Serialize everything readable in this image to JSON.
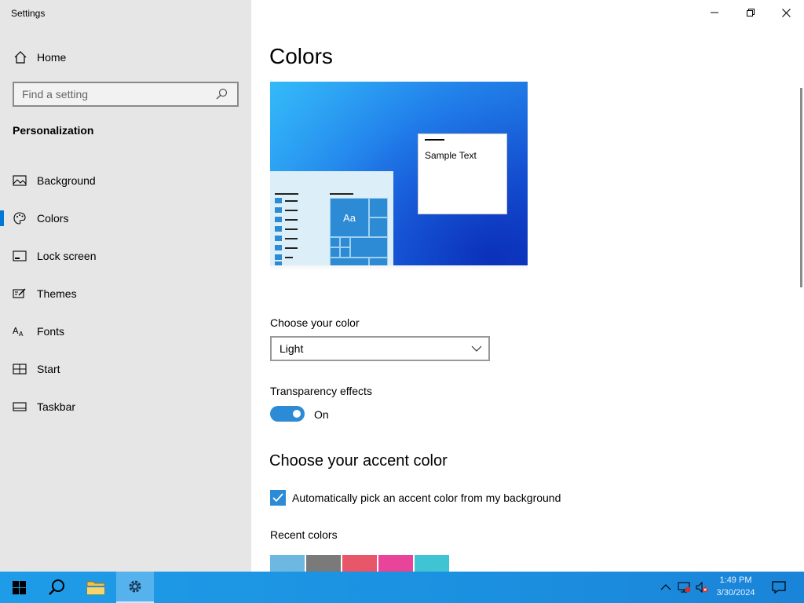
{
  "app": {
    "title": "Settings"
  },
  "sidebar": {
    "home": "Home",
    "search_placeholder": "Find a setting",
    "section": "Personalization",
    "items": [
      {
        "label": "Background",
        "icon": "picture-icon"
      },
      {
        "label": "Colors",
        "icon": "palette-icon",
        "selected": true
      },
      {
        "label": "Lock screen",
        "icon": "lock-screen-icon"
      },
      {
        "label": "Themes",
        "icon": "themes-icon"
      },
      {
        "label": "Fonts",
        "icon": "fonts-icon"
      },
      {
        "label": "Start",
        "icon": "start-icon"
      },
      {
        "label": "Taskbar",
        "icon": "taskbar-icon"
      }
    ]
  },
  "main": {
    "title": "Colors",
    "preview_sample_text": "Sample Text",
    "preview_tile_text": "Aa",
    "choose_color_label": "Choose your color",
    "choose_color_value": "Light",
    "transparency_label": "Transparency effects",
    "transparency_state": "On",
    "accent_heading": "Choose your accent color",
    "auto_accent_label": "Automatically pick an accent color from my background",
    "recent_colors_label": "Recent colors",
    "recent_colors": [
      "#6cb8e0",
      "#7a7a7a",
      "#e8566a",
      "#e8449a",
      "#40c4d4"
    ]
  },
  "taskbar": {
    "clock_time": "1:49 PM",
    "clock_date": "3/30/2024"
  },
  "colors": {
    "accent": "#2d8ad4",
    "sidebar_bg": "#e6e6e6",
    "taskbar": "#1e9ce8"
  }
}
